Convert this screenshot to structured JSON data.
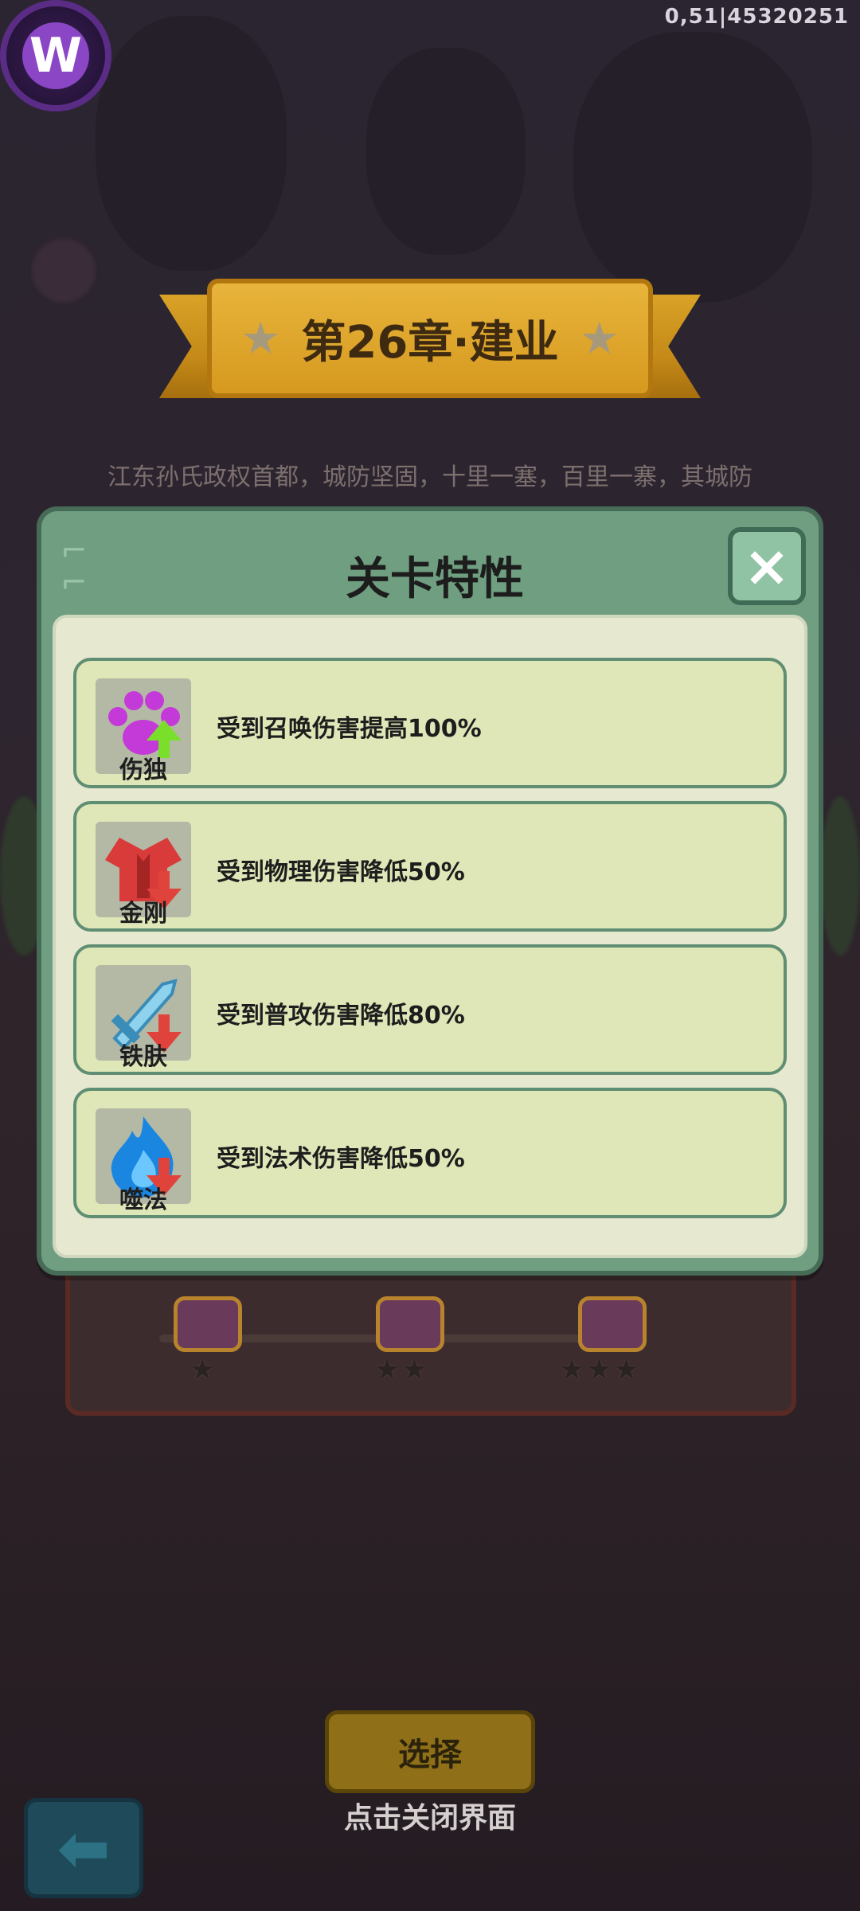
{
  "top_right_text": "0,51|45320251",
  "logo": {
    "letter": "W"
  },
  "chapter": {
    "title": "第26章·建业",
    "description": "江东孙氏政权首都，城防坚固，十里一塞，百里一寨，其城防"
  },
  "modal": {
    "title": "关卡特性",
    "close_icon": "×",
    "traits": [
      {
        "name": "伤独",
        "text": "受到召唤伤害提高100%",
        "icon": "paw-icon",
        "direction": "up",
        "icon_color": "#c43ad8"
      },
      {
        "name": "金刚",
        "text": "受到物理伤害降低50%",
        "icon": "armor-icon",
        "direction": "down",
        "icon_color": "#d93a3a"
      },
      {
        "name": "铁肤",
        "text": "受到普攻伤害降低80%",
        "icon": "sword-icon",
        "direction": "down",
        "icon_color": "#8fd2ee"
      },
      {
        "name": "噬法",
        "text": "受到法术伤害降低50%",
        "icon": "flame-icon",
        "direction": "down",
        "icon_color": "#1a86e0"
      }
    ]
  },
  "rewards": {
    "tiers": [
      "★",
      "★★",
      "★★★"
    ]
  },
  "buttons": {
    "select_label": "选择",
    "close_hint": "点击关闭界面",
    "back_icon": "⬅"
  },
  "colors": {
    "modal_frame": "#6f9f80",
    "trait_card": "#dfe6b7",
    "banner_gold": "#d6991f"
  }
}
